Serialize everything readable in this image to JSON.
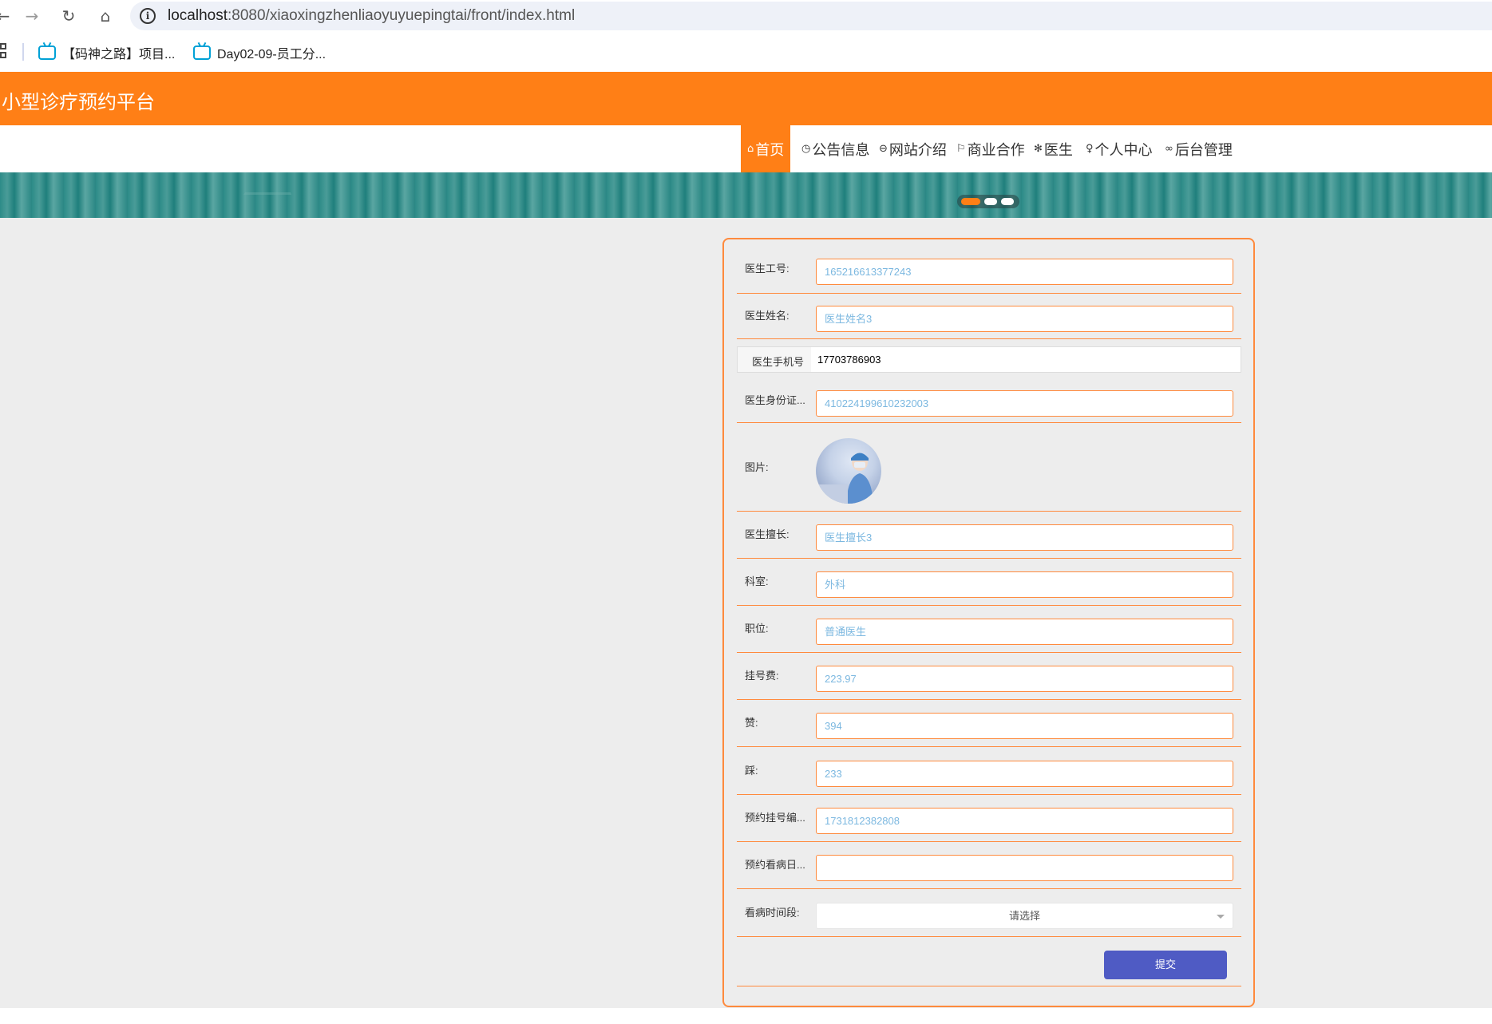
{
  "browser": {
    "url_host": "localhost",
    "url_rest": ":8080/xiaoxingzhenliaoyuyuepingtai/front/index.html",
    "bookmarks": [
      {
        "label": "【码神之路】项目..."
      },
      {
        "label": "Day02-09-员工分..."
      }
    ]
  },
  "header": {
    "title": "小型诊疗预约平台"
  },
  "nav": {
    "items": [
      {
        "label": "首页",
        "icon": "home-icon",
        "glyph": "⌂"
      },
      {
        "label": "公告信息",
        "icon": "clock-icon",
        "glyph": "◷"
      },
      {
        "label": "网站介绍",
        "icon": "screen-icon",
        "glyph": "⊖"
      },
      {
        "label": "商业合作",
        "icon": "flag-icon",
        "glyph": "⚐"
      },
      {
        "label": "医生",
        "icon": "snowflake-icon",
        "glyph": "✻"
      },
      {
        "label": "个人中心",
        "icon": "user-icon",
        "glyph": "♀"
      },
      {
        "label": "后台管理",
        "icon": "link-icon",
        "glyph": "∞"
      }
    ]
  },
  "banner": {
    "active_slide": 1,
    "slide_count": 3
  },
  "form": {
    "doctor_id": {
      "label": "医生工号:",
      "value": "165216613377243"
    },
    "doctor_name": {
      "label": "医生姓名:",
      "value": "医生姓名3"
    },
    "doctor_phone": {
      "label": "医生手机号",
      "value": "17703786903"
    },
    "doctor_idcard": {
      "label": "医生身份证...",
      "value": "410224199610232003"
    },
    "photo": {
      "label": "图片:"
    },
    "specialty": {
      "label": "医生擅长:",
      "value": "医生擅长3"
    },
    "department": {
      "label": "科室:",
      "value": "外科"
    },
    "position": {
      "label": "职位:",
      "value": "普通医生"
    },
    "fee": {
      "label": "挂号费:",
      "value": "223.97"
    },
    "likes": {
      "label": "赞:",
      "value": "394"
    },
    "dislikes": {
      "label": "踩:",
      "value": "233"
    },
    "booking_no": {
      "label": "预约挂号编...",
      "value": "1731812382808"
    },
    "booking_date": {
      "label": "预约看病日...",
      "value": ""
    },
    "time_slot": {
      "label": "看病时间段:",
      "placeholder": "请选择"
    },
    "submit_label": "提交"
  },
  "colors": {
    "brand": "#ff7f16",
    "submit": "#4f5bc4",
    "input_text": "#7cb8e0"
  }
}
